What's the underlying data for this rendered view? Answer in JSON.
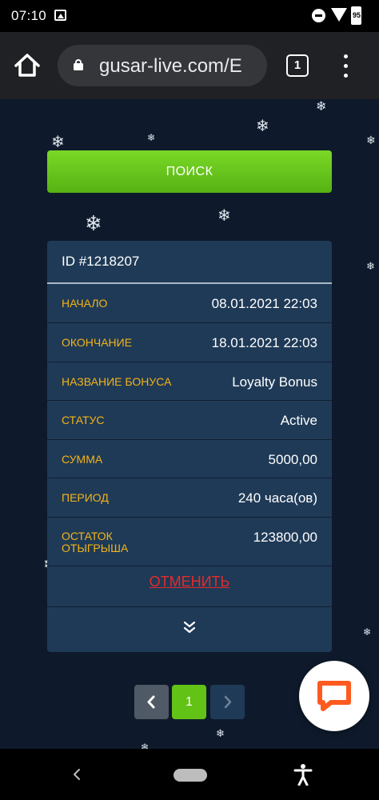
{
  "status_bar": {
    "time": "07:10",
    "battery": "95",
    "icons": [
      "image-icon",
      "do-not-disturb-icon",
      "wifi-icon",
      "battery-icon"
    ]
  },
  "browser": {
    "url": "gusar-live.com/E",
    "tab_count": "1",
    "icons": [
      "home-icon",
      "lock-icon",
      "tabs-icon",
      "more-vert-icon"
    ]
  },
  "page": {
    "search_label": "ПОИСК",
    "bonus": {
      "title": "ID #1218207",
      "rows": [
        {
          "label": "НАЧАЛО",
          "value": "08.01.2021 22:03"
        },
        {
          "label": "ОКОНЧАНИЕ",
          "value": "18.01.2021 22:03"
        },
        {
          "label": "НАЗВАНИЕ БОНУСА",
          "value": "Loyalty Bonus"
        },
        {
          "label": "СТАТУС",
          "value": "Active"
        },
        {
          "label": "СУММА",
          "value": "5000,00"
        },
        {
          "label": "ПЕРИОД",
          "value": "240 часа(ов)"
        },
        {
          "label_line1": "ОСТАТОК",
          "label_line2": "ОТЫГРЫША",
          "value": "123800,00"
        }
      ],
      "cancel_label": "ОТМЕНИТЬ"
    },
    "pagination": {
      "current_page": "1"
    }
  },
  "colors": {
    "background": "#0e1a2b",
    "card": "#1f3a57",
    "accent_green": "#62c216",
    "label_yellow": "#f2b418",
    "cancel_red": "#e22b2b",
    "chat_orange": "#ff5a1f"
  }
}
